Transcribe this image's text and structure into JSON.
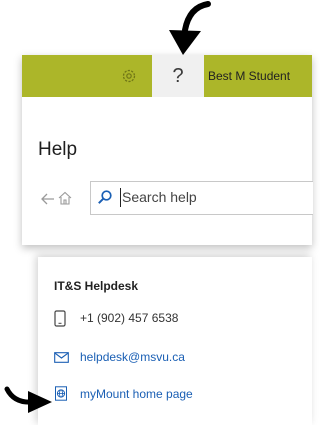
{
  "window": {
    "user_name": "Best M Student",
    "help_glyph": "?"
  },
  "help_pane": {
    "title": "Help",
    "search_placeholder": "Search help"
  },
  "helpdesk": {
    "title": "IT&S Helpdesk",
    "phone": "+1 (902) 457 6538",
    "email": "helpdesk@msvu.ca",
    "home_link": "myMount home page"
  },
  "colors": {
    "title_bar": "#acb629",
    "link": "#1a5fb4"
  },
  "icons": [
    "gear-icon",
    "help-icon",
    "back-arrow-icon",
    "home-icon",
    "search-icon",
    "phone-icon",
    "mail-icon",
    "globe-icon",
    "pointer-arrow-icon"
  ]
}
